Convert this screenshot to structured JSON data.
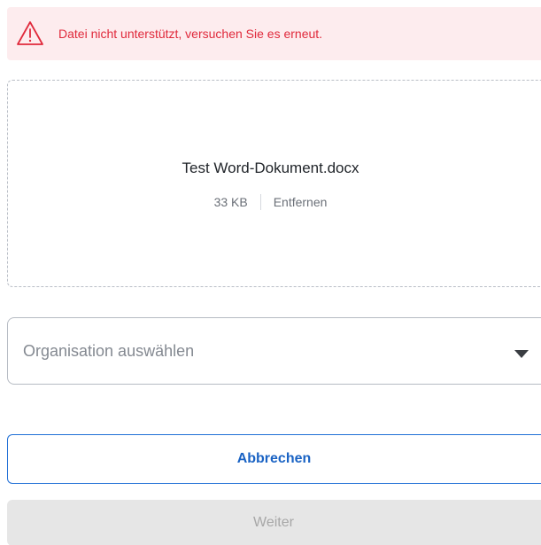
{
  "error": {
    "icon": "warning-triangle-icon",
    "message": "Datei nicht unterstützt, versuchen Sie es erneut.",
    "color": "#e0293b",
    "background": "#fdecee"
  },
  "file": {
    "name": "Test Word-Dokument.docx",
    "size": "33 KB",
    "remove_label": "Entfernen"
  },
  "organization_select": {
    "placeholder": "Organisation auswählen",
    "icon": "caret-down-icon"
  },
  "buttons": {
    "cancel_label": "Abbrechen",
    "next_label": "Weiter"
  },
  "colors": {
    "accent": "#1a63c4",
    "disabled_bg": "#e6e6e6",
    "disabled_text": "#a7a7a7"
  }
}
